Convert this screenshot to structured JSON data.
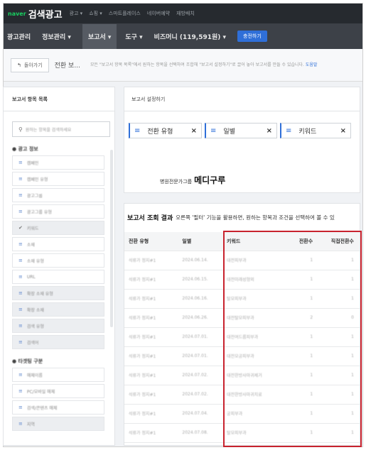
{
  "topbar": {
    "logo_prefix": "naver",
    "logo": "검색광고",
    "nav": [
      "광고 ▾",
      "쇼핑 ▾",
      "스마트플레이스",
      "네이버예약",
      "재방배치"
    ]
  },
  "mainnav": {
    "items": [
      "광고관리",
      "정보관리 ▾",
      "보고서 ▾",
      "도구 ▾",
      "비즈머니 (119,591원) ▾"
    ],
    "button": "충전하기"
  },
  "toolbar": {
    "back_label": "돌아가기",
    "page_name": "전환 보...",
    "help_text": "모든 \"보고서 항목 목록\"에서 원하는 항목을 선택하여 조합해 \"보고서 설정하기\"로 끌어 놓아 보고서를 만들 수 있습니다.",
    "help_link": "도움말"
  },
  "sidebar": {
    "header": "보고서 항목 목록",
    "search_placeholder": "원하는 항목을 검색하세요",
    "groups": [
      {
        "title": "광고 정보",
        "items": [
          "캠페인",
          "캠페인 유형",
          "광고그룹",
          "광고그룹 유형",
          "키워드",
          "소재",
          "소재 유형",
          "URL",
          "확장 소재 유형",
          "확장 소재",
          "검색 유형",
          "검색어"
        ]
      },
      {
        "title": "타겟팅 구분",
        "items": [
          "매체이름",
          "PC/모바일 매체",
          "검색/콘텐츠 매체",
          "지역"
        ]
      }
    ]
  },
  "filter": {
    "header": "보고서 설정하기",
    "chips": [
      "전환 유형",
      "일별",
      "키워드"
    ]
  },
  "brand": {
    "small": "병원전문가그룹",
    "big": "메디구루"
  },
  "results": {
    "title": "보고서 조회 결과",
    "description": "오른쪽 '필터' 기능을 활용하면, 원하는 항목과 조건을 선택하여 볼 수 있",
    "columns": [
      "전환 유형",
      "일별",
      "키워드",
      "전환수",
      "직접전환수"
    ],
    "rows": [
      [
        "석류가 정지#1",
        "2024.06.14.",
        "대전피부과",
        "1",
        "1"
      ],
      [
        "석류가 정지#1",
        "2024.06.15.",
        "대전미래성형외",
        "1",
        "1"
      ],
      [
        "석류가 정지#1",
        "2024.06.16.",
        "탈모피부과",
        "1",
        "1"
      ],
      [
        "석류가 정지#1",
        "2024.06.26.",
        "대전탈모피부과",
        "2",
        "0"
      ],
      [
        "석류가 정지#1",
        "2024.07.01.",
        "대전여드름피부과",
        "1",
        "1"
      ],
      [
        "석류가 정지#1",
        "2024.07.01.",
        "대전모공피부과",
        "1",
        "1"
      ],
      [
        "석류가 정지#1",
        "2024.07.02.",
        "대전한방사마귀제거",
        "1",
        "1"
      ],
      [
        "석류가 정지#1",
        "2024.07.02.",
        "대전한방사마귀치료",
        "1",
        "1"
      ],
      [
        "석류가 정지#1",
        "2024.07.04.",
        "궁피부과",
        "1",
        "1"
      ],
      [
        "석류가 정지#1",
        "2024.07.08.",
        "탈모피부과",
        "1",
        "1"
      ]
    ]
  },
  "colors": {
    "accent": "#2f6fd8",
    "highlight": "#c8232e",
    "nav_bg": "#3d4148"
  }
}
